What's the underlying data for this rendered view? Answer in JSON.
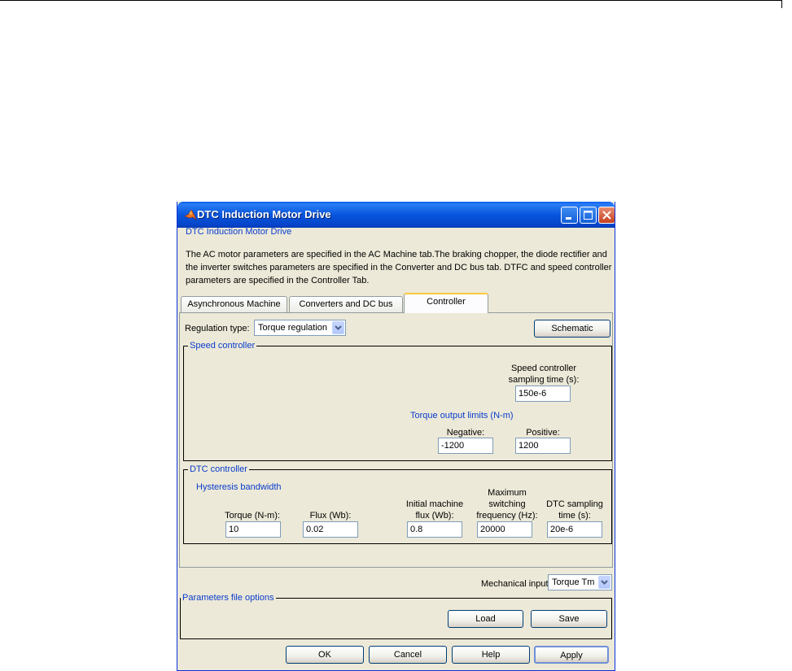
{
  "window": {
    "title": "DTC Induction Motor Drive",
    "header": "DTC Induction Motor Drive",
    "description": [
      "The AC motor parameters are specified in the AC Machine tab.The braking chopper, the diode rectifier and",
      "the inverter switches parameters are specified in the Converter and DC bus tab. DTFC and speed controller",
      "parameters are specified in the Controller Tab."
    ]
  },
  "tabs": [
    "Asynchronous Machine",
    "Converters and DC bus",
    "Controller"
  ],
  "controller": {
    "regulation_label": "Regulation type:",
    "regulation_value": "Torque regulation",
    "schematic_label": "Schematic",
    "speed": {
      "label": "Speed controller",
      "sampling_label_1": "Speed controller",
      "sampling_label_2": "sampling time (s):",
      "sampling_value": "150e-6",
      "torque_limits_label": "Torque output limits (N-m)",
      "negative_label": "Negative:",
      "negative_value": "-1200",
      "positive_label": "Positive:",
      "positive_value": "1200"
    },
    "dtc": {
      "label": "DTC controller",
      "hysteresis_label": "Hysteresis bandwidth",
      "torque_label": "Torque (N-m):",
      "torque_value": "10",
      "flux_label": "Flux (Wb):",
      "flux_value": "0.02",
      "init_flux_label_1": "Initial machine",
      "init_flux_label_2": "flux (Wb):",
      "init_flux_value": "0.8",
      "max_sw_label_1": "Maximum",
      "max_sw_label_2": "switching",
      "max_sw_label_3": "frequency (Hz):",
      "max_sw_value": "20000",
      "dtc_sampling_label_1": "DTC sampling",
      "dtc_sampling_label_2": "time (s):",
      "dtc_sampling_value": "20e-6"
    }
  },
  "mechanical": {
    "label": "Mechanical input:",
    "value": "Torque Tm"
  },
  "params_file": {
    "label": "Parameters file options",
    "load_label": "Load",
    "save_label": "Save"
  },
  "buttons": {
    "ok": "OK",
    "cancel": "Cancel",
    "help": "Help",
    "apply": "Apply"
  }
}
